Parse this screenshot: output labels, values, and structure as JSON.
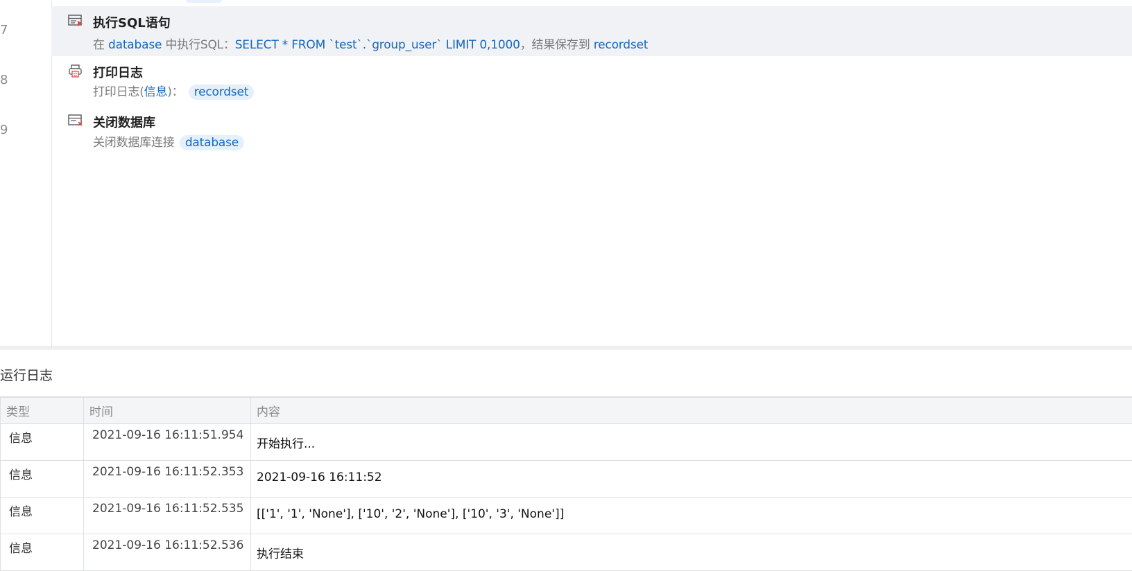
{
  "gutter": {
    "line_numbers": [
      "7",
      "8",
      "9"
    ]
  },
  "steps": [
    {
      "title": "执行SQL语句",
      "prefix": "在",
      "db_var": "database",
      "middle": "中执行SQL：",
      "sql": "SELECT * FROM `test`.`group_user` LIMIT 0,1000",
      "save_text": "，结果保存到",
      "result_var": "recordset",
      "icon": "sql-execute-icon"
    },
    {
      "title": "打印日志",
      "prefix": "打印日志(",
      "level": "信息",
      "suffix": ")：",
      "var": "recordset",
      "icon": "printer-icon"
    },
    {
      "title": "关闭数据库",
      "prefix": "关闭数据库连接",
      "var": "database",
      "icon": "close-database-icon"
    }
  ],
  "log": {
    "title": "运行日志",
    "columns": [
      "类型",
      "时间",
      "内容"
    ],
    "rows": [
      {
        "type": "信息",
        "time": "2021-09-16 16:11:51.954",
        "content": "开始执行..."
      },
      {
        "type": "信息",
        "time": "2021-09-16 16:11:52.353",
        "content": "2021-09-16 16:11:52"
      },
      {
        "type": "信息",
        "time": "2021-09-16 16:11:52.535",
        "content": "[['1', '1', 'None'], ['10', '2', 'None'], ['10', '3', 'None']]"
      },
      {
        "type": "信息",
        "time": "2021-09-16 16:11:52.536",
        "content": "执行结束"
      }
    ]
  },
  "colors": {
    "accent": "#1668c0",
    "chip_bg": "#e6f0fb",
    "selected_bg": "#f0f2f5",
    "error_red": "#e04848"
  }
}
